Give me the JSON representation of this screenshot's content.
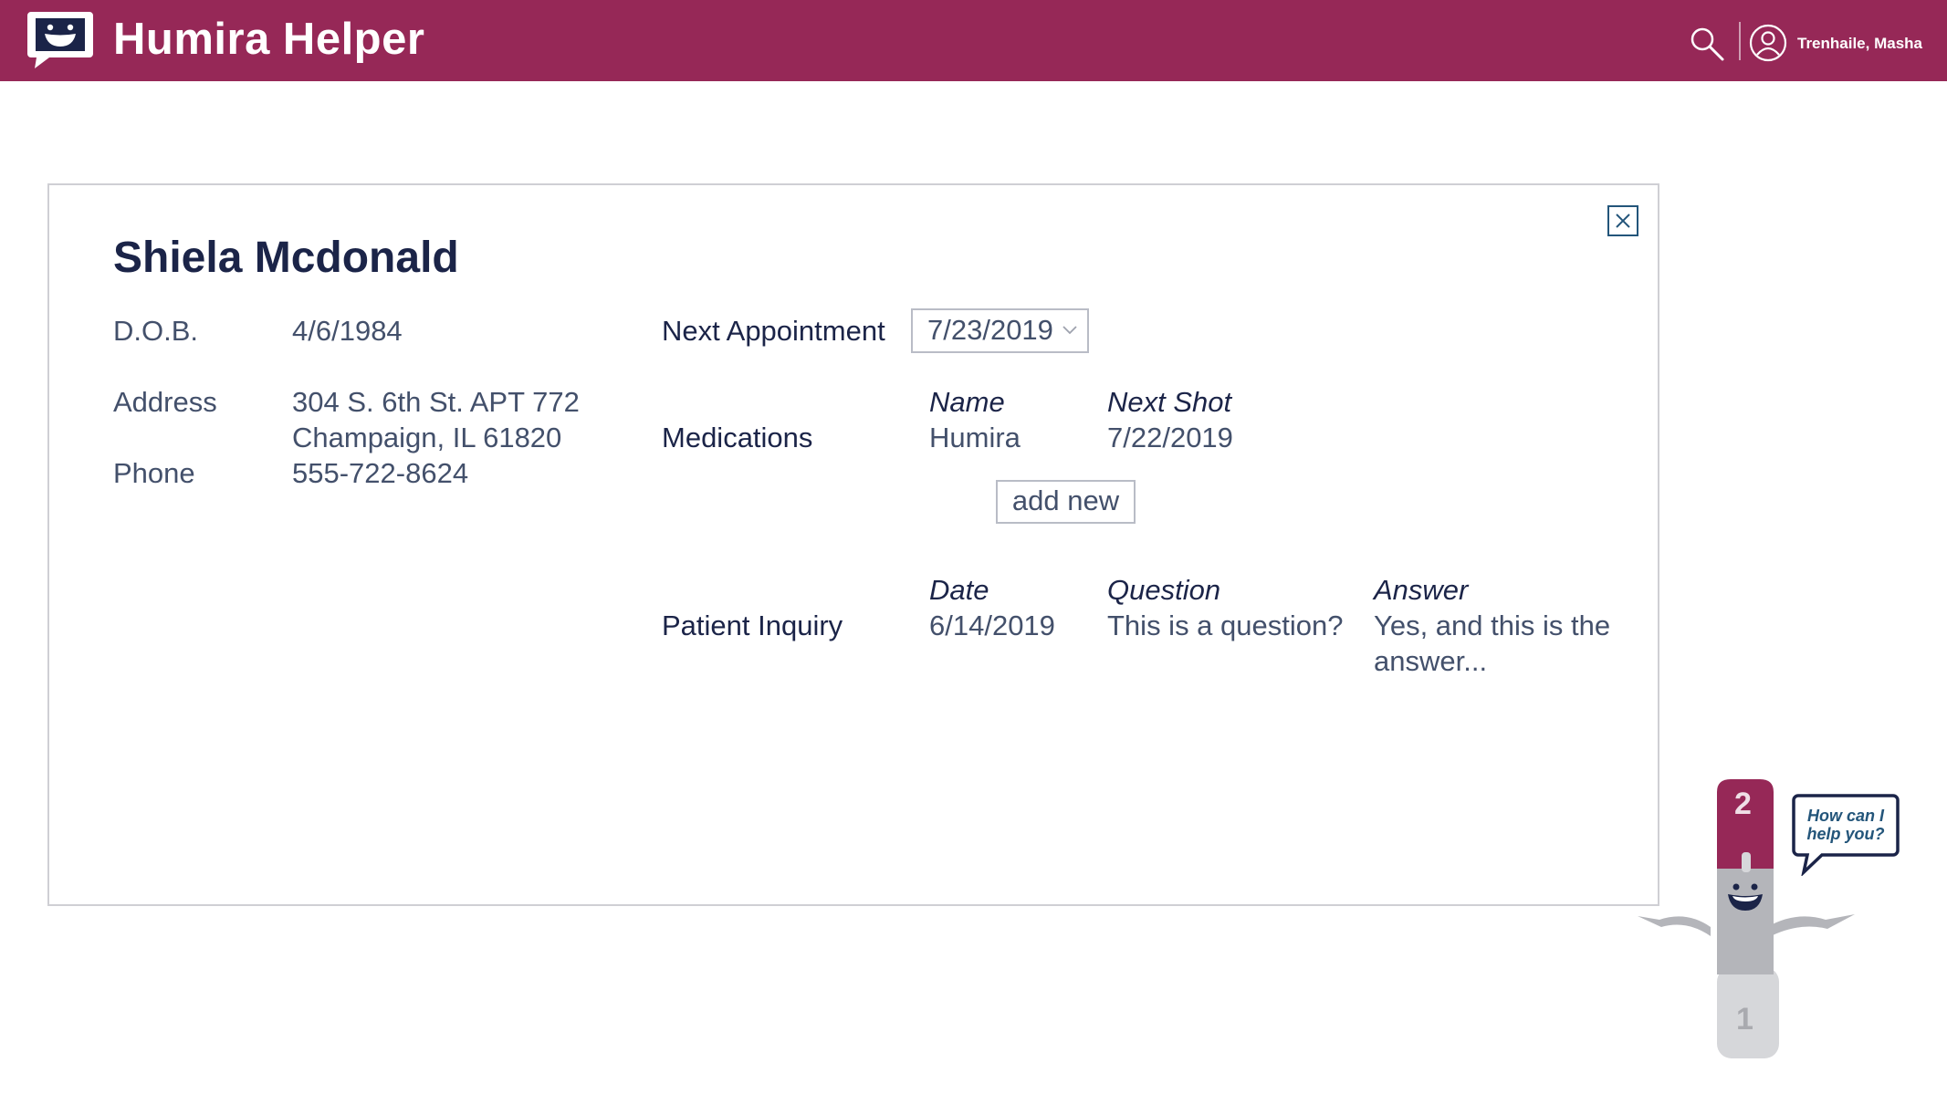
{
  "header": {
    "app_title": "Humira Helper",
    "user_name": "Trenhaile, Masha",
    "brand_color": "#962857",
    "icons": [
      "chat-logo-icon",
      "search-icon",
      "user-icon"
    ]
  },
  "patient": {
    "name": "Shiela Mcdonald",
    "dob_label": "D.O.B.",
    "dob": "4/6/1984",
    "address_label": "Address",
    "address_line1": "304 S. 6th St. APT 772",
    "address_line2": "Champaign, IL 61820",
    "phone_label": "Phone",
    "phone": "555-722-8624"
  },
  "appointment": {
    "label": "Next Appointment",
    "selected": "7/23/2019"
  },
  "medications": {
    "label": "Medications",
    "col_name": "Name",
    "col_next_shot": "Next Shot",
    "rows": [
      {
        "name": "Humira",
        "next_shot": "7/22/2019"
      }
    ],
    "add_label": "add new"
  },
  "inquiry": {
    "label": "Patient Inquiry",
    "col_date": "Date",
    "col_question": "Question",
    "col_answer": "Answer",
    "rows": [
      {
        "date": "6/14/2019",
        "question": "This is a question?",
        "answer_line1": "Yes, and this is the",
        "answer_line2": "answer..."
      }
    ]
  },
  "assistant": {
    "prompt": "How can I help you?",
    "top_number": "2",
    "bottom_number": "1"
  }
}
